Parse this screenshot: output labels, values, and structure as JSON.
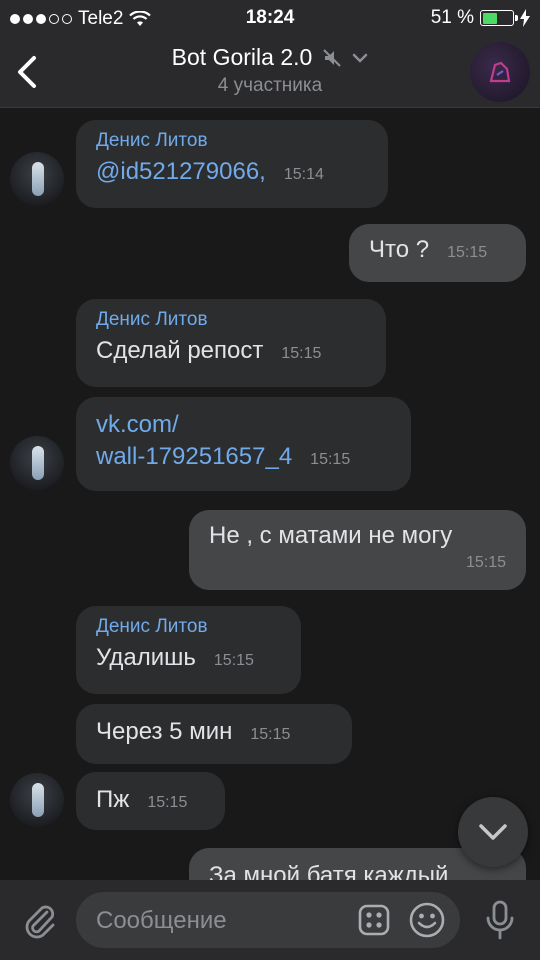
{
  "status_bar": {
    "carrier": "Tele2",
    "time": "18:24",
    "battery": "51 %",
    "battery_level": 0.51
  },
  "header": {
    "back_icon": "chevron-left-icon",
    "title": "Bot Gorila 2.0",
    "mute_icon": "muted-bell-icon",
    "dropdown_icon": "chevron-down-icon",
    "subtitle": "4 участника"
  },
  "messages": [
    {
      "author": "Денис Литов",
      "text": "@id521279066,",
      "time": "15:14"
    },
    {
      "text": "Что ?",
      "time": "15:15"
    },
    {
      "author": "Денис Литов",
      "text": "Сделай репост",
      "time": "15:15"
    },
    {
      "text_line1": "vk.com/",
      "text_line2": "wall-179251657_4",
      "time": "15:15"
    },
    {
      "text": "Не , с матами не могу",
      "time": "15:15"
    },
    {
      "author": "Денис Литов",
      "text": "Удалишь",
      "time": "15:15"
    },
    {
      "text": "Через 5 мин",
      "time": "15:15"
    },
    {
      "text": "Пж",
      "time": "15:15"
    },
    {
      "text": "За мной батя каждый"
    }
  ],
  "composer": {
    "placeholder": "Сообщение",
    "attach_icon": "paperclip-icon",
    "keyboard_icon": "bot-keyboard-icon",
    "emoji_icon": "smile-icon",
    "mic_icon": "microphone-icon"
  },
  "scroll_icon": "chevron-down-icon"
}
